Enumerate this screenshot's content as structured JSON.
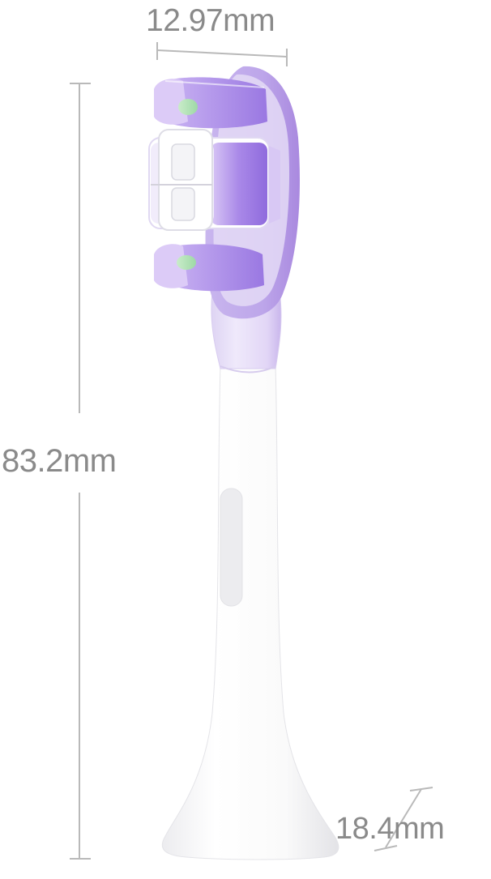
{
  "product": {
    "name": "electric toothbrush replacement head",
    "head_color": "#b69ae6",
    "body_color": "#f6f6f6"
  },
  "dimensions": {
    "width_label": "12.97mm",
    "length_label": "83.2mm",
    "base_label": "18.4mm"
  },
  "style": {
    "dimension_line_color": "#b9b9b9",
    "label_color": "#8a8a8a"
  }
}
